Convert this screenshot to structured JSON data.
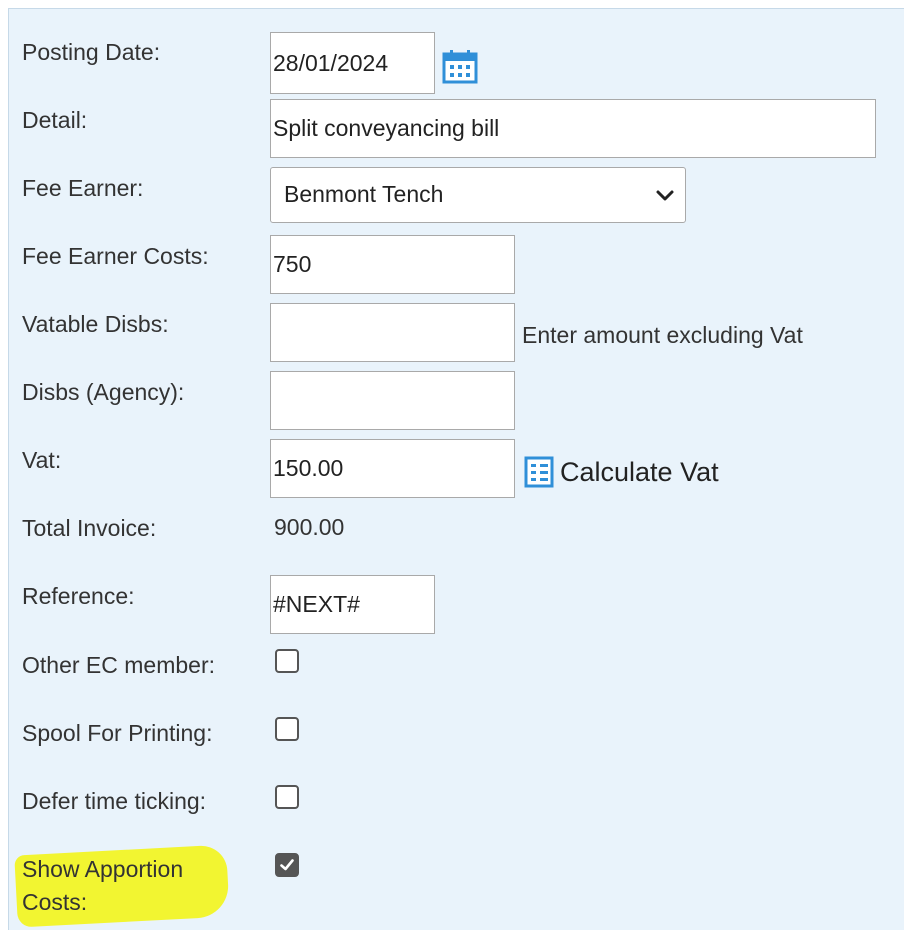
{
  "form": {
    "posting_date": {
      "label": "Posting Date:",
      "value": "28/01/2024"
    },
    "detail": {
      "label": "Detail:",
      "value": "Split conveyancing bill"
    },
    "fee_earner": {
      "label": "Fee Earner:",
      "selected": "Benmont Tench"
    },
    "fee_earner_costs": {
      "label": "Fee Earner Costs:",
      "value": "750"
    },
    "vatable_disbs": {
      "label": "Vatable Disbs:",
      "value": "",
      "hint": "Enter amount excluding Vat"
    },
    "disbs_agency": {
      "label": "Disbs (Agency):",
      "value": ""
    },
    "vat": {
      "label": "Vat:",
      "value": "150.00",
      "calculate_label": "Calculate Vat"
    },
    "total_invoice": {
      "label": "Total Invoice:",
      "value": "900.00"
    },
    "reference": {
      "label": "Reference:",
      "value": "#NEXT#"
    },
    "other_ec_member": {
      "label": "Other EC member:",
      "checked": false
    },
    "spool_for_printing": {
      "label": "Spool For Printing:",
      "checked": false
    },
    "defer_time_ticking": {
      "label": "Defer time ticking:",
      "checked": false
    },
    "show_apportion_costs": {
      "label_line1": "Show Apportion",
      "label_line2": "Costs:",
      "checked": true
    }
  },
  "colors": {
    "panel_background": "#e9f3fb",
    "icon_blue": "#2f8fd8",
    "highlight": "#f2f520"
  },
  "icons": {
    "date_picker": "calendar-icon",
    "calculate": "calculator-icon",
    "dropdown": "chevron-down-icon",
    "check": "checkmark-icon"
  }
}
